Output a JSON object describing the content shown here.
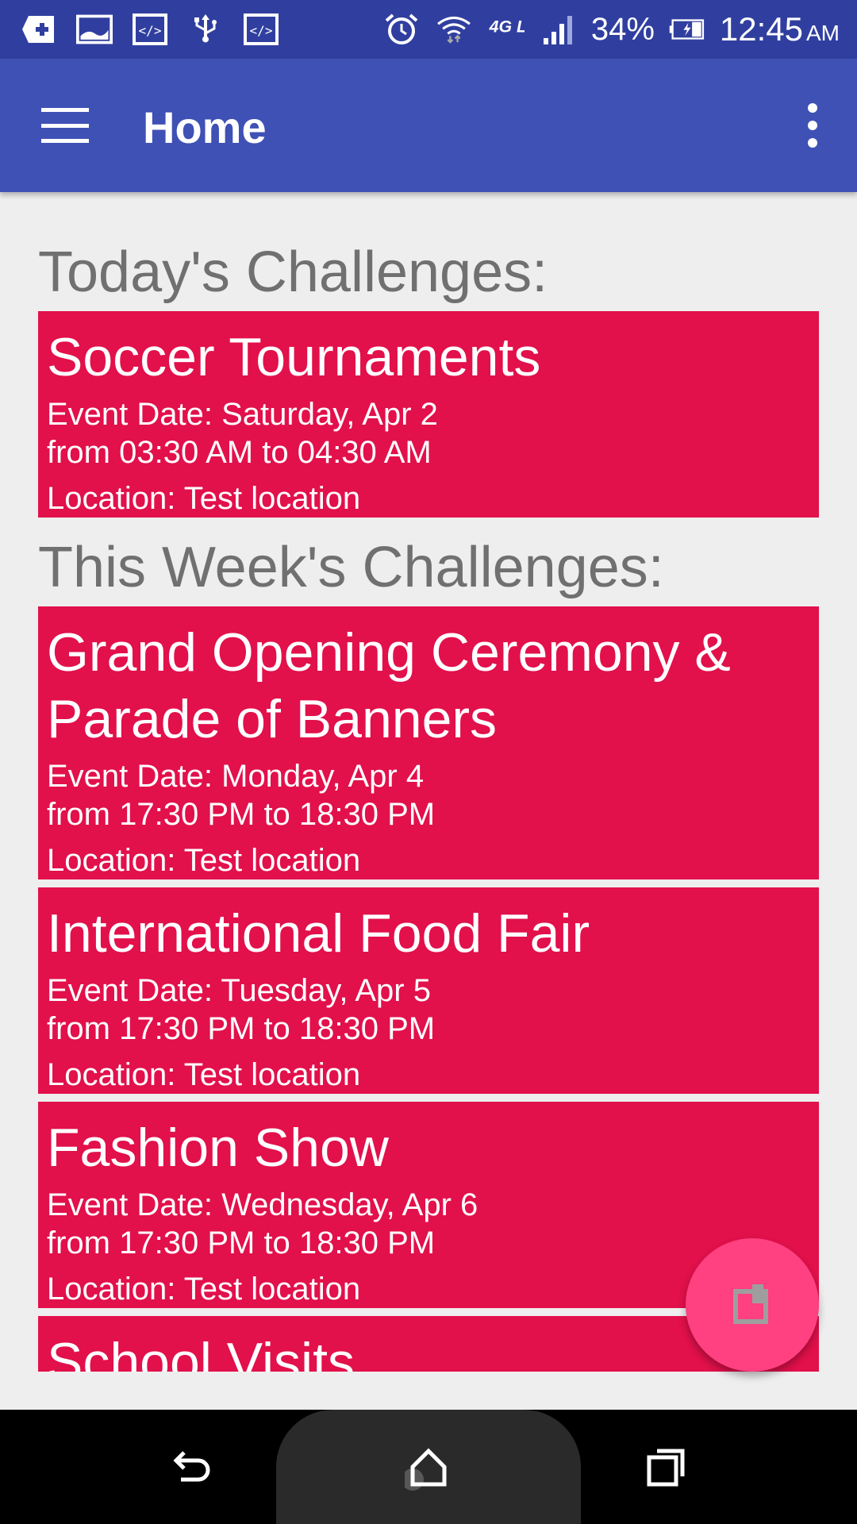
{
  "status_bar": {
    "battery": "34%",
    "time": "12:45",
    "ampm": "AM",
    "network": "4G LTE",
    "icons": [
      "first-aid-icon",
      "image-icon",
      "code-icon",
      "usb-icon",
      "code-icon",
      "alarm-icon",
      "wifi-icon",
      "lte-icon",
      "signal-icon",
      "battery-icon"
    ]
  },
  "app_bar": {
    "title": "Home"
  },
  "sections": {
    "today": "Today's Challenges:",
    "week": "This Week's Challenges:"
  },
  "events": [
    {
      "title": "Soccer Tournaments",
      "date": "Event Date: Saturday, Apr 2",
      "time": "from 03:30 AM to 04:30 AM",
      "location": "Location: Test location"
    },
    {
      "title_line1": "Grand Opening Ceremony &",
      "title_line2": "Parade of Banners",
      "date": "Event Date: Monday, Apr 4",
      "time": "from 17:30 PM to 18:30 PM",
      "location": "Location: Test location"
    },
    {
      "title": "International Food Fair",
      "date": "Event Date: Tuesday, Apr 5",
      "time": "from 17:30 PM to 18:30 PM",
      "location": "Location: Test location"
    },
    {
      "title": "Fashion Show",
      "date": "Event Date: Wednesday, Apr 6",
      "time": "from 17:30 PM to 18:30 PM",
      "location": "Location: Test location"
    },
    {
      "title": "School Visits"
    }
  ],
  "colors": {
    "status_bar": "#303f9f",
    "app_bar": "#3f51b5",
    "card": "#e2104b",
    "fab": "#ff4081",
    "heading_text": "#707070"
  }
}
